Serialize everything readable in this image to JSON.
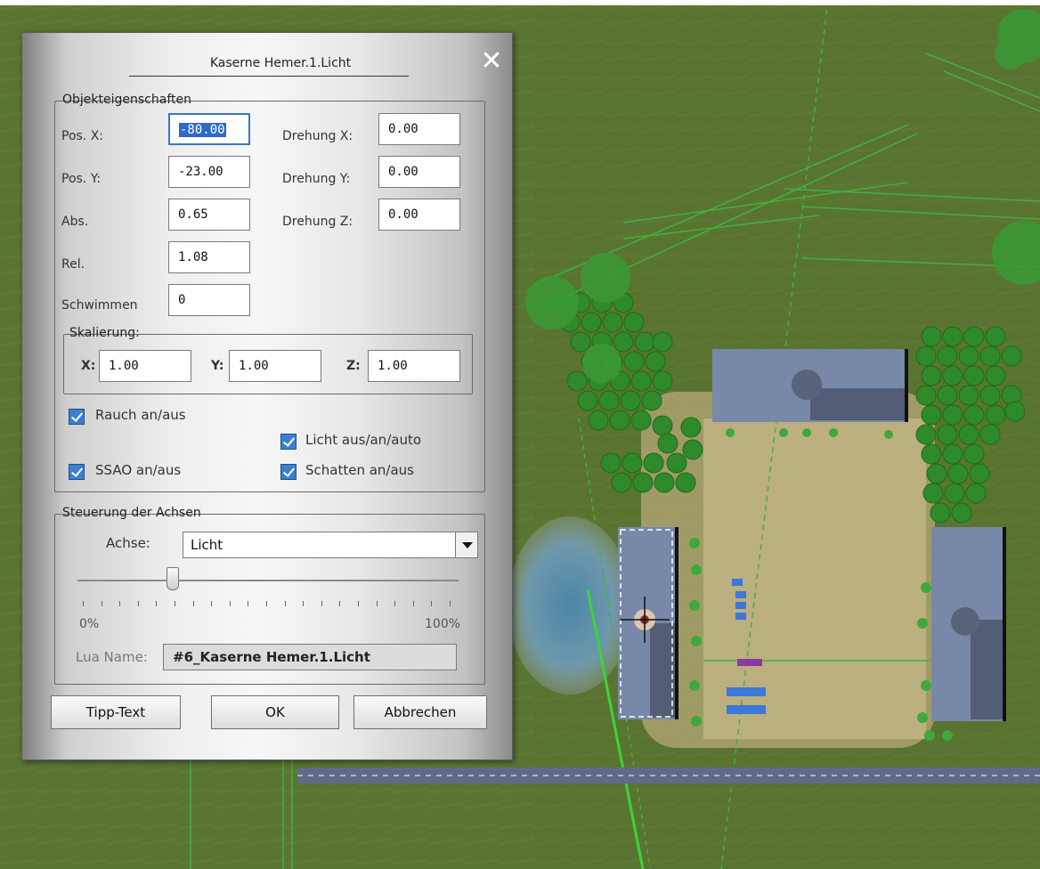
{
  "window_title": "Kaserne Hemer.1.Licht",
  "top_strip_text": "",
  "properties": {
    "legend": "Objekteigenschaften",
    "pos_x": {
      "label": "Pos. X:",
      "value": "-80.00"
    },
    "pos_y": {
      "label": "Pos. Y:",
      "value": "-23.00"
    },
    "abs": {
      "label": "Abs.",
      "value": "0.65"
    },
    "rel": {
      "label": "Rel.",
      "value": "1.08"
    },
    "schwimmen": {
      "label": "Schwimmen",
      "value": "0"
    },
    "rot_x": {
      "label": "Drehung X:",
      "value": "0.00"
    },
    "rot_y": {
      "label": "Drehung Y:",
      "value": "0.00"
    },
    "rot_z": {
      "label": "Drehung Z:",
      "value": "0.00"
    }
  },
  "scaling": {
    "legend": "Skalierung:",
    "x": {
      "label": "X:",
      "value": "1.00"
    },
    "y": {
      "label": "Y:",
      "value": "1.00"
    },
    "z": {
      "label": "Z:",
      "value": "1.00"
    }
  },
  "checkboxes": {
    "rauch": {
      "label": "Rauch an/aus",
      "checked": true
    },
    "licht": {
      "label": "Licht aus/an/auto",
      "checked": true
    },
    "ssao": {
      "label": "SSAO an/aus",
      "checked": true
    },
    "schatten": {
      "label": "Schatten an/aus",
      "checked": true
    }
  },
  "axes": {
    "legend": "Steuerung der Achsen",
    "axis_label": "Achse:",
    "axis_value": "Licht",
    "slider_min_label": "0%",
    "slider_max_label": "100%",
    "slider_value": 0.25,
    "lua_label": "Lua Name:",
    "lua_value": "#6_Kaserne Hemer.1.Licht"
  },
  "buttons": {
    "tipp": "Tipp-Text",
    "ok": "OK",
    "cancel": "Abbrechen"
  },
  "colors": {
    "checkbox": "#3d7fcf",
    "selection": "#2e69c8",
    "building": "#7888a8",
    "tree": "#2f8a2a"
  }
}
